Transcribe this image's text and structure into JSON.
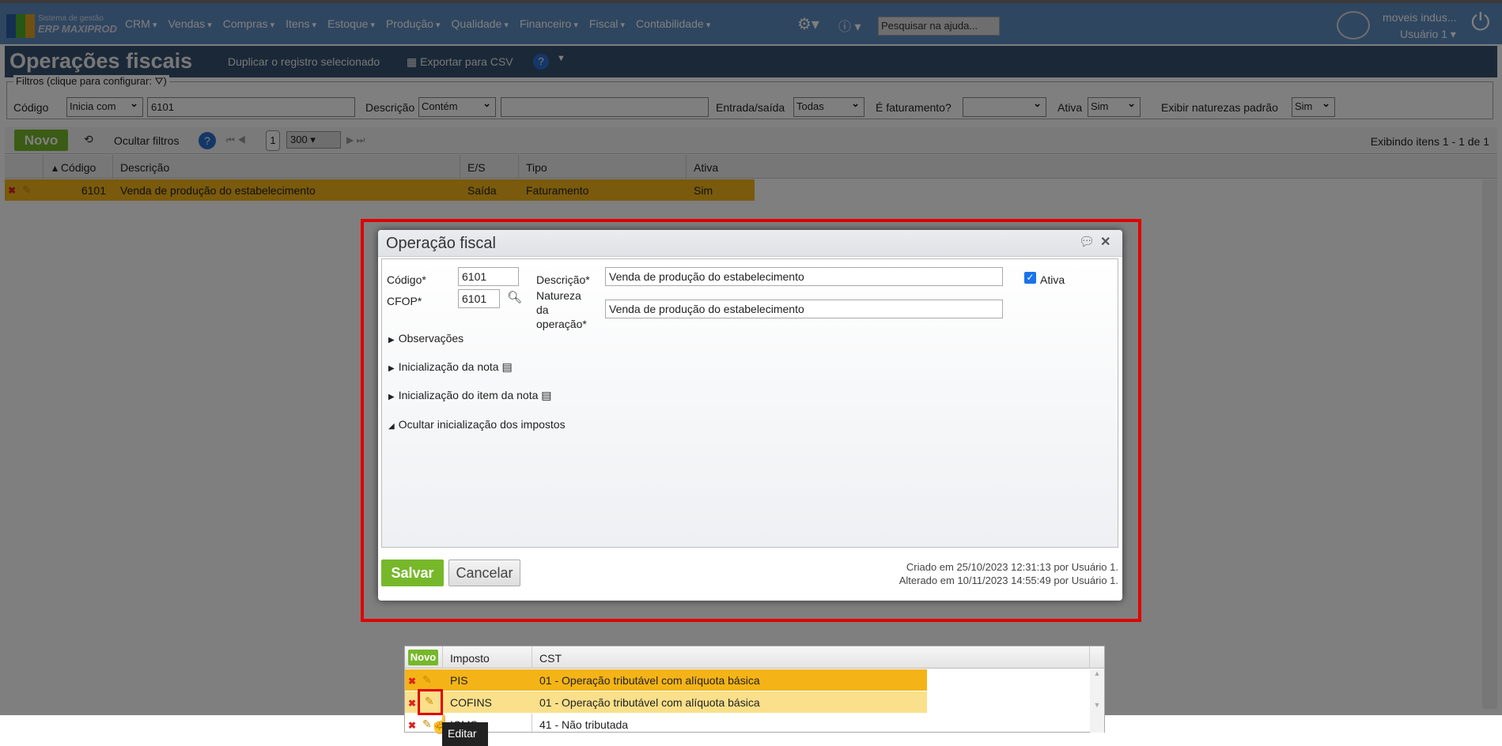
{
  "nav": {
    "logo_line1": "Sistema de gestão",
    "logo_line2": "ERP MAXIPROD",
    "menus": [
      "CRM",
      "Vendas",
      "Compras",
      "Itens",
      "Estoque",
      "Produção",
      "Qualidade",
      "Financeiro",
      "Fiscal",
      "Contabilidade"
    ],
    "search_placeholder": "Pesquisar na ajuda...",
    "company": "moveis indus...",
    "user": "Usuário 1"
  },
  "page": {
    "title": "Operações fiscais",
    "duplicate": "Duplicar o registro selecionado",
    "export": "Exportar para CSV"
  },
  "filters": {
    "legend": "Filtros (clique para configurar:",
    "codigo_label": "Código",
    "codigo_op": "Inicia com",
    "codigo_value": "6101",
    "descricao_label": "Descrição",
    "descricao_op": "Contém",
    "descricao_value": "",
    "es_label": "Entrada/saída",
    "es_value": "Todas",
    "fat_label": "É faturamento?",
    "fat_value": "",
    "ativa_label": "Ativa",
    "ativa_value": "Sim",
    "nat_label": "Exibir naturezas padrão",
    "nat_value": "Sim"
  },
  "toolbar": {
    "novo": "Novo",
    "hide_filters": "Ocultar filtros",
    "page": "1",
    "page_size": "300",
    "status": "Exibindo itens 1 - 1 de 1"
  },
  "grid": {
    "headers": [
      "Código",
      "Descrição",
      "E/S",
      "Tipo",
      "Ativa"
    ],
    "rows": [
      {
        "codigo": "6101",
        "descricao": "Venda de produção do estabelecimento",
        "es": "Saída",
        "tipo": "Faturamento",
        "ativa": "Sim"
      }
    ]
  },
  "dialog": {
    "title": "Operação fiscal",
    "codigo_label": "Código*",
    "codigo": "6101",
    "descricao_label": "Descrição*",
    "descricao": "Venda de produção do estabelecimento",
    "ativa_label": "Ativa",
    "cfop_label": "CFOP*",
    "cfop": "6101",
    "natureza_label_1": "Natureza",
    "natureza_label_2": "da",
    "natureza_label_3": "operação*",
    "natureza": "Venda de produção do estabelecimento",
    "sections": [
      "Observações",
      "Inicialização da nota",
      "Inicialização do item da nota",
      "Ocultar inicialização dos impostos"
    ],
    "taxes": {
      "novo": "Novo",
      "headers": [
        "Imposto",
        "CST"
      ],
      "rows": [
        {
          "imposto": "PIS",
          "cst": "01 - Operação tributável com alíquota básica"
        },
        {
          "imposto": "COFINS",
          "cst": "01 - Operação tributável com alíquota básica"
        },
        {
          "imposto": "ICMS",
          "cst": "41 - Não tributada"
        }
      ]
    },
    "tooltip": "Editar",
    "save": "Salvar",
    "cancel": "Cancelar",
    "created": "Criado em 25/10/2023 12:31:13 por Usuário 1.",
    "modified": "Alterado em 10/11/2023 14:55:49 por Usuário 1."
  }
}
